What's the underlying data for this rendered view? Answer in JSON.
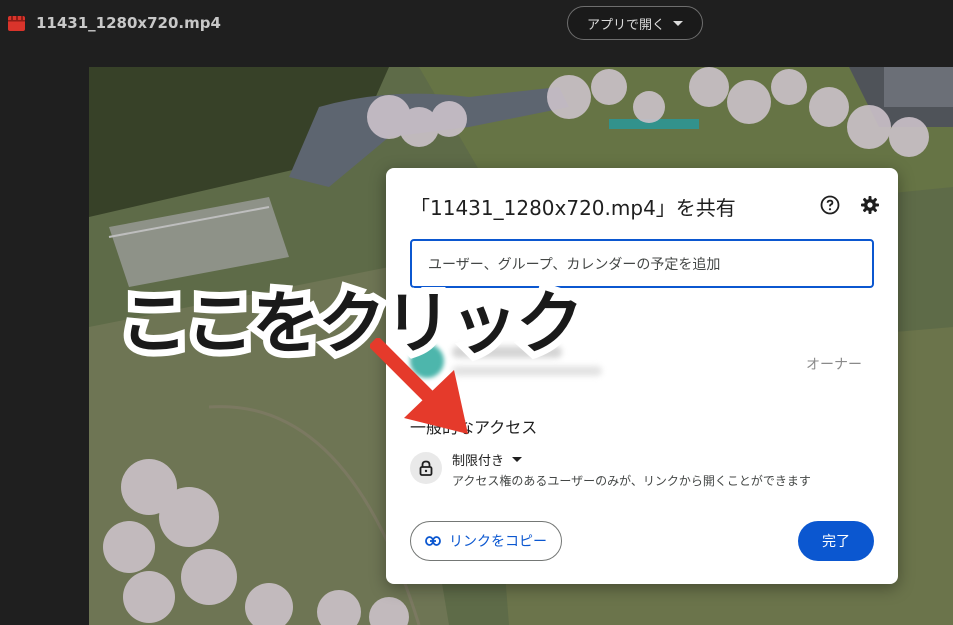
{
  "header": {
    "file_name": "11431_1280x720.mp4",
    "open_with_label": "アプリで開く"
  },
  "dialog": {
    "title": "「11431_1280x720.mp4」を共有",
    "add_people_placeholder": "ユーザー、グループ、カレンダーの予定を追加",
    "people": [
      {
        "role": "オーナー"
      }
    ],
    "general_access_heading": "一般的なアクセス",
    "access_level": "制限付き",
    "access_description": "アクセス権のあるユーザーのみが、リンクから開くことができます",
    "copy_link_label": "リンクをコピー",
    "done_label": "完了"
  },
  "annotation": {
    "text": "ここをクリック",
    "arrow_color": "#e53a2b"
  },
  "colors": {
    "accent": "#0b57d0",
    "video_icon": "#d9342b"
  },
  "icons": [
    "video-file-icon",
    "chevron-down-icon",
    "help-icon",
    "gear-icon",
    "lock-icon",
    "link-icon"
  ]
}
